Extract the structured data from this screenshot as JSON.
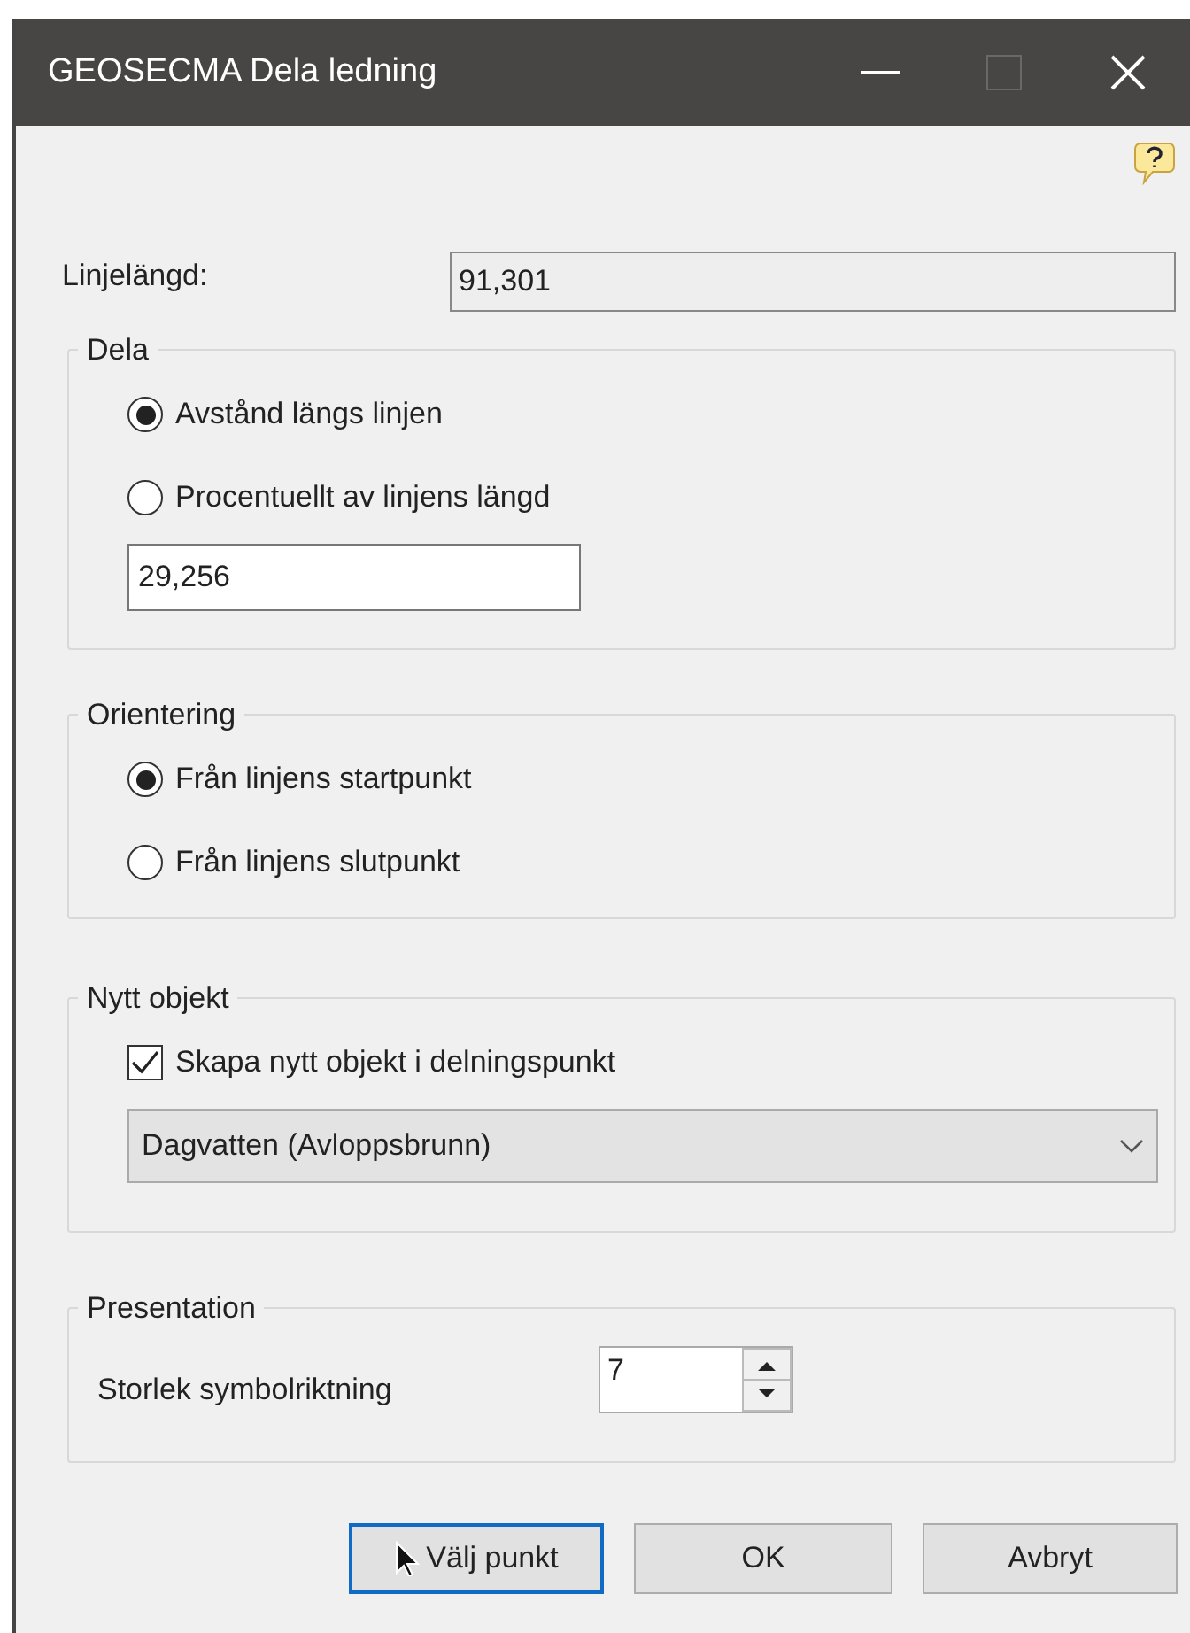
{
  "window": {
    "title": "GEOSECMA Dela ledning"
  },
  "length": {
    "label": "Linjelängd:",
    "value": "91,301"
  },
  "split": {
    "legend": "Dela",
    "options": [
      {
        "label": "Avstånd längs linjen",
        "selected": true
      },
      {
        "label": "Procentuellt av linjens längd",
        "selected": false
      }
    ],
    "value": "29,256"
  },
  "orientation": {
    "legend": "Orientering",
    "options": [
      {
        "label": "Från linjens startpunkt",
        "selected": true
      },
      {
        "label": "Från linjens slutpunkt",
        "selected": false
      }
    ]
  },
  "new_object": {
    "legend": "Nytt objekt",
    "checkbox": {
      "label": "Skapa nytt objekt i delningspunkt",
      "checked": true
    },
    "dropdown": "Dagvatten (Avloppsbrunn)"
  },
  "presentation": {
    "legend": "Presentation",
    "label": "Storlek symbolriktning",
    "value": "7"
  },
  "buttons": [
    {
      "label": "Välj punkt",
      "focused": true
    },
    {
      "label": "OK",
      "focused": false
    },
    {
      "label": "Avbryt",
      "focused": false
    }
  ]
}
